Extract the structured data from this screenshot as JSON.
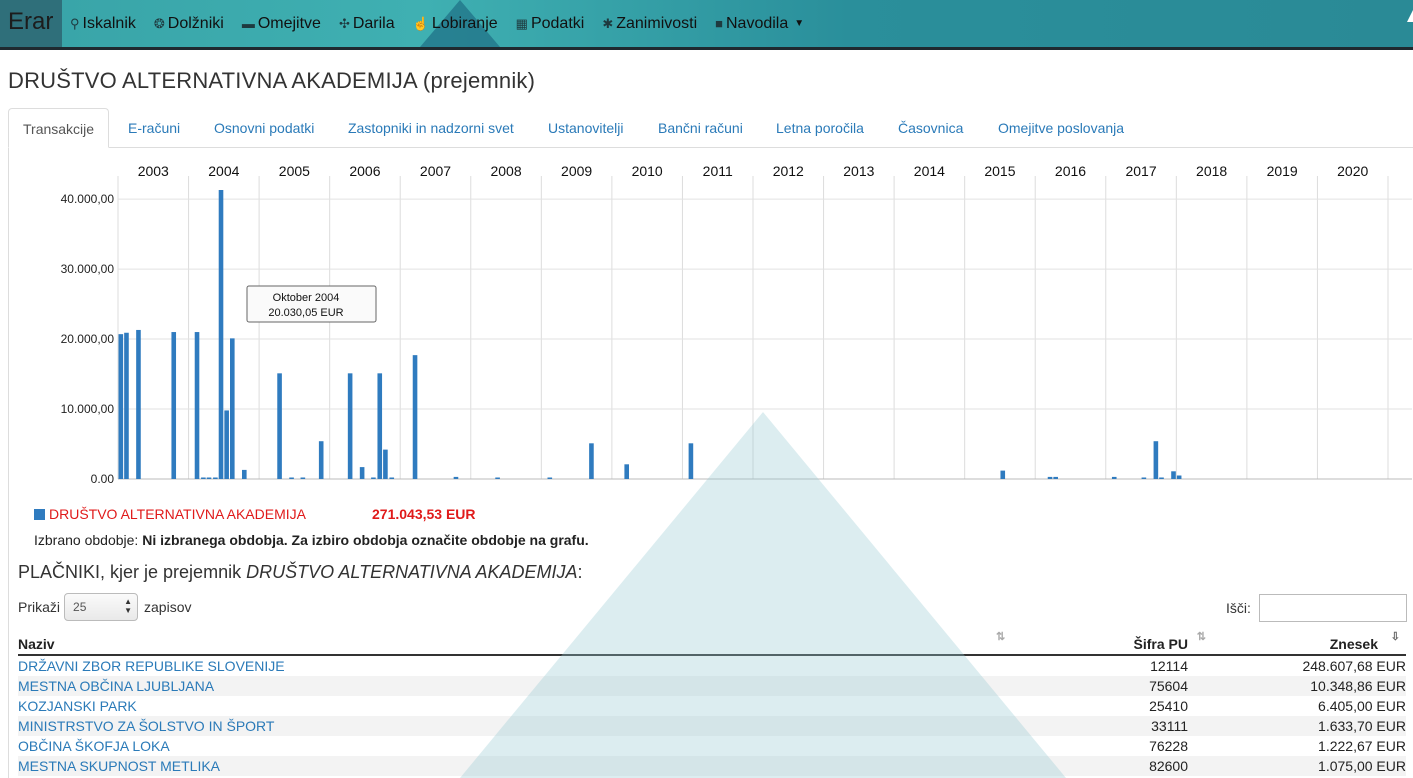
{
  "nav": {
    "brand": "Erar",
    "items": [
      {
        "label": "Iskalnik",
        "icon": "search-icon",
        "glyph": "⚲"
      },
      {
        "label": "Dolžniki",
        "icon": "coins-icon",
        "glyph": "❂"
      },
      {
        "label": "Omejitve",
        "icon": "briefcase-icon",
        "glyph": "▬"
      },
      {
        "label": "Darila",
        "icon": "gift-icon",
        "glyph": "✣"
      },
      {
        "label": "Lobiranje",
        "icon": "hand-icon",
        "glyph": "☝"
      },
      {
        "label": "Podatki",
        "icon": "grid-icon",
        "glyph": "▦"
      },
      {
        "label": "Zanimivosti",
        "icon": "asterisk-icon",
        "glyph": "✱"
      },
      {
        "label": "Navodila",
        "icon": "book-icon",
        "glyph": "■"
      }
    ]
  },
  "page": {
    "title": "DRUŠTVO ALTERNATIVNA AKADEMIJA (prejemnik)"
  },
  "tabs": [
    {
      "label": "Transakcije",
      "active": true
    },
    {
      "label": "E-računi"
    },
    {
      "label": "Osnovni podatki"
    },
    {
      "label": "Zastopniki in nadzorni svet"
    },
    {
      "label": "Ustanovitelji"
    },
    {
      "label": "Bančni računi"
    },
    {
      "label": "Letna poročila"
    },
    {
      "label": "Časovnica"
    },
    {
      "label": "Omejitve poslovanja"
    }
  ],
  "chart_data": {
    "type": "bar",
    "x_label_years": [
      "2003",
      "2004",
      "2005",
      "2006",
      "2007",
      "2008",
      "2009",
      "2010",
      "2011",
      "2012",
      "2013",
      "2014",
      "2015",
      "2016",
      "2017",
      "2018",
      "2019",
      "2020"
    ],
    "y_ticks": [
      "40.000,00",
      "30.000,00",
      "20.000,00",
      "10.000,00",
      "0.00"
    ],
    "ylim": [
      0,
      42000
    ],
    "series_color": "#2f7bbf",
    "bars": [
      {
        "t": 2003.04,
        "v": 20700
      },
      {
        "t": 2003.12,
        "v": 20900
      },
      {
        "t": 2003.29,
        "v": 21300
      },
      {
        "t": 2003.79,
        "v": 21000
      },
      {
        "t": 2004.12,
        "v": 21000
      },
      {
        "t": 2004.21,
        "v": 150
      },
      {
        "t": 2004.29,
        "v": 150
      },
      {
        "t": 2004.38,
        "v": 150
      },
      {
        "t": 2004.46,
        "v": 41300
      },
      {
        "t": 2004.54,
        "v": 9800
      },
      {
        "t": 2004.62,
        "v": 20100
      },
      {
        "t": 2004.79,
        "v": 1300
      },
      {
        "t": 2005.29,
        "v": 15100
      },
      {
        "t": 2005.46,
        "v": 150
      },
      {
        "t": 2005.62,
        "v": 200
      },
      {
        "t": 2005.88,
        "v": 5400
      },
      {
        "t": 2006.29,
        "v": 15100
      },
      {
        "t": 2006.46,
        "v": 1700
      },
      {
        "t": 2006.62,
        "v": 200
      },
      {
        "t": 2006.71,
        "v": 15100
      },
      {
        "t": 2006.79,
        "v": 4200
      },
      {
        "t": 2006.88,
        "v": 150
      },
      {
        "t": 2007.21,
        "v": 17700
      },
      {
        "t": 2007.79,
        "v": 300
      },
      {
        "t": 2008.38,
        "v": 150
      },
      {
        "t": 2009.12,
        "v": 150
      },
      {
        "t": 2009.71,
        "v": 5100
      },
      {
        "t": 2010.21,
        "v": 2100
      },
      {
        "t": 2011.12,
        "v": 5100
      },
      {
        "t": 2015.54,
        "v": 1200
      },
      {
        "t": 2016.21,
        "v": 300
      },
      {
        "t": 2016.29,
        "v": 300
      },
      {
        "t": 2017.12,
        "v": 300
      },
      {
        "t": 2017.54,
        "v": 150
      },
      {
        "t": 2017.71,
        "v": 5400
      },
      {
        "t": 2017.79,
        "v": 200
      },
      {
        "t": 2017.96,
        "v": 1100
      },
      {
        "t": 2018.04,
        "v": 500
      }
    ],
    "tooltip": {
      "line1": "Oktober 2004",
      "line2": "20.030,05 EUR"
    }
  },
  "legend": {
    "name": "DRUŠTVO ALTERNATIVNA AKADEMIJA",
    "total": "271.043,53 EUR"
  },
  "selected_period": {
    "label": "Izbrano obdobje:",
    "value": "Ni izbranega obdobja. Za izbiro obdobja označite obdobje na grafu."
  },
  "payers_heading": {
    "prefix": "PLAČNIKI, kjer je prejemnik ",
    "entity": "DRUŠTVO ALTERNATIVNA AKADEMIJA",
    "suffix": ":"
  },
  "table_controls": {
    "show_label": "Prikaži",
    "page_size": "25",
    "records_label": "zapisov",
    "search_label": "Išči:"
  },
  "table": {
    "columns": [
      "Naziv",
      "Šifra PU",
      "Znesek"
    ],
    "rows": [
      {
        "name": "DRŽAVNI ZBOR REPUBLIKE SLOVENIJE",
        "code": "12114",
        "amount": "248.607,68 EUR"
      },
      {
        "name": "MESTNA OBČINA LJUBLJANA",
        "code": "75604",
        "amount": "10.348,86 EUR"
      },
      {
        "name": "KOZJANSKI PARK",
        "code": "25410",
        "amount": "6.405,00 EUR"
      },
      {
        "name": "MINISTRSTVO ZA ŠOLSTVO IN ŠPORT",
        "code": "33111",
        "amount": "1.633,70 EUR"
      },
      {
        "name": "OBČINA ŠKOFJA LOKA",
        "code": "76228",
        "amount": "1.222,67 EUR"
      },
      {
        "name": "MESTNA SKUPNOST METLIKA",
        "code": "82600",
        "amount": "1.075,00 EUR"
      }
    ]
  }
}
